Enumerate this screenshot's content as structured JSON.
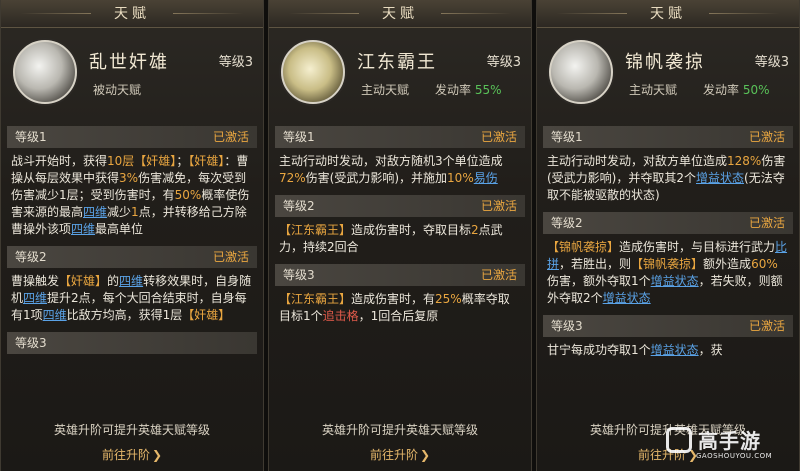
{
  "panels": [
    {
      "title": "天赋",
      "name": "乱世奸雄",
      "level": "等级3",
      "type": "被动天赋",
      "rate_label": "",
      "rate_value": "",
      "sections": [
        {
          "level": "等级1",
          "status": "已激活",
          "segments": [
            {
              "t": "战斗开始时，获得"
            },
            {
              "t": "10层",
              "c": "o"
            },
            {
              "t": "【奸雄】",
              "c": "o"
            },
            {
              "t": "；"
            },
            {
              "t": "【奸雄】",
              "c": "o"
            },
            {
              "t": "：曹操从每层效果中获得"
            },
            {
              "t": "3%",
              "c": "o"
            },
            {
              "t": "伤害减免，每次受到伤害减少1层；受到伤害时，有"
            },
            {
              "t": "50%",
              "c": "o"
            },
            {
              "t": "概率使伤害来源的最高"
            },
            {
              "t": "四维",
              "c": "b"
            },
            {
              "t": "减少"
            },
            {
              "t": "1",
              "c": "o"
            },
            {
              "t": "点，并转移给己方除曹操外该项"
            },
            {
              "t": "四维",
              "c": "b"
            },
            {
              "t": "最高单位"
            }
          ]
        },
        {
          "level": "等级2",
          "status": "已激活",
          "segments": [
            {
              "t": "曹操触发"
            },
            {
              "t": "【奸雄】",
              "c": "o"
            },
            {
              "t": "的"
            },
            {
              "t": "四维",
              "c": "b"
            },
            {
              "t": "转移效果时，自身随机"
            },
            {
              "t": "四维",
              "c": "b"
            },
            {
              "t": "提升2点，每个大回合结束时，自身每有1项"
            },
            {
              "t": "四维",
              "c": "b"
            },
            {
              "t": "比敌方均高，获得1层"
            },
            {
              "t": "【奸雄】",
              "c": "o"
            }
          ]
        },
        {
          "level": "等级3",
          "status": "",
          "segments": []
        }
      ],
      "footer_text": "英雄升阶可提升英雄天赋等级",
      "footer_button": "前往升阶"
    },
    {
      "title": "天赋",
      "name": "江东霸王",
      "level": "等级3",
      "type": "主动天赋",
      "rate_label": "发动率",
      "rate_value": "55%",
      "sections": [
        {
          "level": "等级1",
          "status": "已激活",
          "segments": [
            {
              "t": "主动行动时发动，对敌方随机3个单位造成"
            },
            {
              "t": "72%",
              "c": "o"
            },
            {
              "t": "伤害(受武力影响)，并施加"
            },
            {
              "t": "10%",
              "c": "o"
            },
            {
              "t": "易伤",
              "c": "b"
            }
          ]
        },
        {
          "level": "等级2",
          "status": "已激活",
          "segments": [
            {
              "t": "【江东霸王】",
              "c": "o"
            },
            {
              "t": "造成伤害时，夺取目标"
            },
            {
              "t": "2",
              "c": "o"
            },
            {
              "t": "点武力，持续2回合"
            }
          ]
        },
        {
          "level": "等级3",
          "status": "已激活",
          "segments": [
            {
              "t": "【江东霸王】",
              "c": "o"
            },
            {
              "t": "造成伤害时，有"
            },
            {
              "t": "25%",
              "c": "o"
            },
            {
              "t": "概率夺取目标1个"
            },
            {
              "t": "追击格",
              "c": "r"
            },
            {
              "t": "，1回合后复原"
            }
          ]
        }
      ],
      "footer_text": "英雄升阶可提升英雄天赋等级",
      "footer_button": "前往升阶"
    },
    {
      "title": "天赋",
      "name": "锦帆袭掠",
      "level": "等级3",
      "type": "主动天赋",
      "rate_label": "发动率",
      "rate_value": "50%",
      "sections": [
        {
          "level": "等级1",
          "status": "已激活",
          "segments": [
            {
              "t": "主动行动时发动，对敌方单位造成"
            },
            {
              "t": "128%",
              "c": "o"
            },
            {
              "t": "伤害(受武力影响)，并夺取其2个"
            },
            {
              "t": "增益状态",
              "c": "b"
            },
            {
              "t": "(无法夺取不能被驱散的状态)"
            }
          ]
        },
        {
          "level": "等级2",
          "status": "已激活",
          "segments": [
            {
              "t": "【锦帆袭掠】",
              "c": "o"
            },
            {
              "t": "造成伤害时，与目标进行武力"
            },
            {
              "t": "比拼",
              "c": "b"
            },
            {
              "t": "，若胜出，则"
            },
            {
              "t": "【锦帆袭掠】",
              "c": "o"
            },
            {
              "t": "额外造成"
            },
            {
              "t": "60%",
              "c": "o"
            },
            {
              "t": "伤害，额外夺取1个"
            },
            {
              "t": "增益状态",
              "c": "b"
            },
            {
              "t": "，若失败，则额外夺取2个"
            },
            {
              "t": "增益状态",
              "c": "b"
            }
          ]
        },
        {
          "level": "等级3",
          "status": "已激活",
          "segments": [
            {
              "t": "甘宁每成功夺取1个"
            },
            {
              "t": "增益状态",
              "c": "b"
            },
            {
              "t": "，获"
            }
          ]
        }
      ],
      "footer_text": "英雄升阶可提升英雄天赋等级",
      "footer_button": "前往升阶"
    }
  ],
  "watermark": {
    "main": "高手游",
    "sub": "GAOSHOUYOU.COM"
  }
}
